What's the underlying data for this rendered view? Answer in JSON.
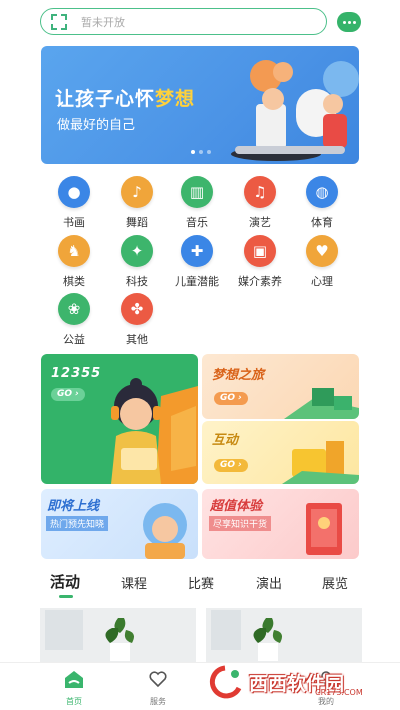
{
  "search": {
    "placeholder": "暂未开放"
  },
  "banner": {
    "line1_a": "让孩子心怀",
    "line1_b": "梦想",
    "line2": "做最好的自己"
  },
  "categories": [
    {
      "label": "书画",
      "icon": "palette-icon",
      "color": "#3b86e6"
    },
    {
      "label": "舞蹈",
      "icon": "dance-icon",
      "color": "#f0a53a"
    },
    {
      "label": "音乐",
      "icon": "piano-icon",
      "color": "#3db56c"
    },
    {
      "label": "演艺",
      "icon": "microphone-icon",
      "color": "#ec5a43"
    },
    {
      "label": "体育",
      "icon": "ball-icon",
      "color": "#3b86e6"
    },
    {
      "label": "棋类",
      "icon": "chess-icon",
      "color": "#f0a53a"
    },
    {
      "label": "科技",
      "icon": "tech-icon",
      "color": "#3db56c"
    },
    {
      "label": "儿童潜能",
      "icon": "puzzle-icon",
      "color": "#3b86e6"
    },
    {
      "label": "媒介素养",
      "icon": "camera-icon",
      "color": "#ec5a43"
    },
    {
      "label": "心理",
      "icon": "heart-icon",
      "color": "#f0a53a"
    },
    {
      "label": "公益",
      "icon": "charity-icon",
      "color": "#3db56c"
    },
    {
      "label": "其他",
      "icon": "clover-icon",
      "color": "#ec5a43"
    }
  ],
  "cards": {
    "hotline": {
      "number": "12355",
      "go": "GO"
    },
    "dream": {
      "title": "梦想之旅",
      "go": "GO"
    },
    "interact": {
      "title": "互动",
      "go": "GO"
    },
    "coming": {
      "title": "即将上线",
      "subtitle": "热门预先知晓"
    },
    "value": {
      "title": "超值体验",
      "subtitle": "尽享知识干货"
    }
  },
  "tabs": [
    "活动",
    "课程",
    "比赛",
    "演出",
    "展览"
  ],
  "nav": [
    {
      "label": "首页",
      "icon": "home-icon"
    },
    {
      "label": "服务",
      "icon": "heart-icon"
    },
    {
      "label": "我的",
      "icon": "user-icon"
    }
  ],
  "watermark": {
    "text": "西西软件园",
    "url": "CR173.COM"
  },
  "colors": {
    "accent": "#3ab56d",
    "banner": "#4b93e6",
    "yellow": "#ffd13b"
  }
}
